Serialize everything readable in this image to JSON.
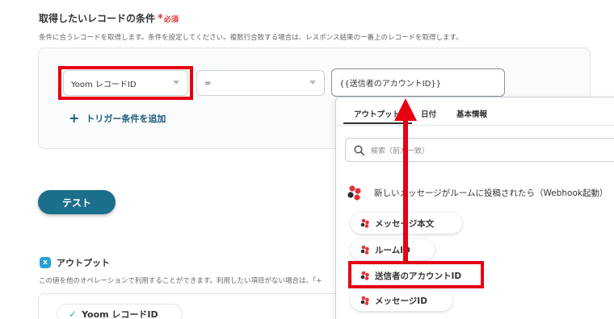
{
  "section": {
    "title": "取得したいレコードの条件",
    "required_star": "*",
    "required_label": "必須",
    "description": "条件に合うレコードを取得します。条件を設定してください。複数行合致する場合は、レスポンス結果の一番上のレコードを取得します。"
  },
  "condition": {
    "field_value": "Yoom レコードID",
    "operator_value": "=",
    "value_input": "{{送信者のアカウントID}}"
  },
  "add_trigger": {
    "plus": "+",
    "label": "トリガー条件を追加"
  },
  "test_button": "テスト",
  "output": {
    "title": "アウトプット",
    "icon_letter": "x",
    "description": "この値を他のオペレーションで利用することができます。利用したい項目がない場合は、「+",
    "chip_check": "✓",
    "chip_label": "Yoom レコードID"
  },
  "dropdown": {
    "tabs": [
      "アウトプット",
      "日付",
      "基本情報"
    ],
    "active_tab": 0,
    "search_placeholder": "検索（前方一致）",
    "trigger_label": "新しいメッセージがルームに投稿されたら（Webhook起動）",
    "items": [
      "メッセージ本文",
      "ルームID",
      "送信者のアカウントID",
      "メッセージID"
    ],
    "highlighted_item": 2
  },
  "colors": {
    "accent": "#1b6f8a",
    "highlight": "#e60012",
    "required": "#e03131",
    "chatwork_red": "#e2353b"
  }
}
